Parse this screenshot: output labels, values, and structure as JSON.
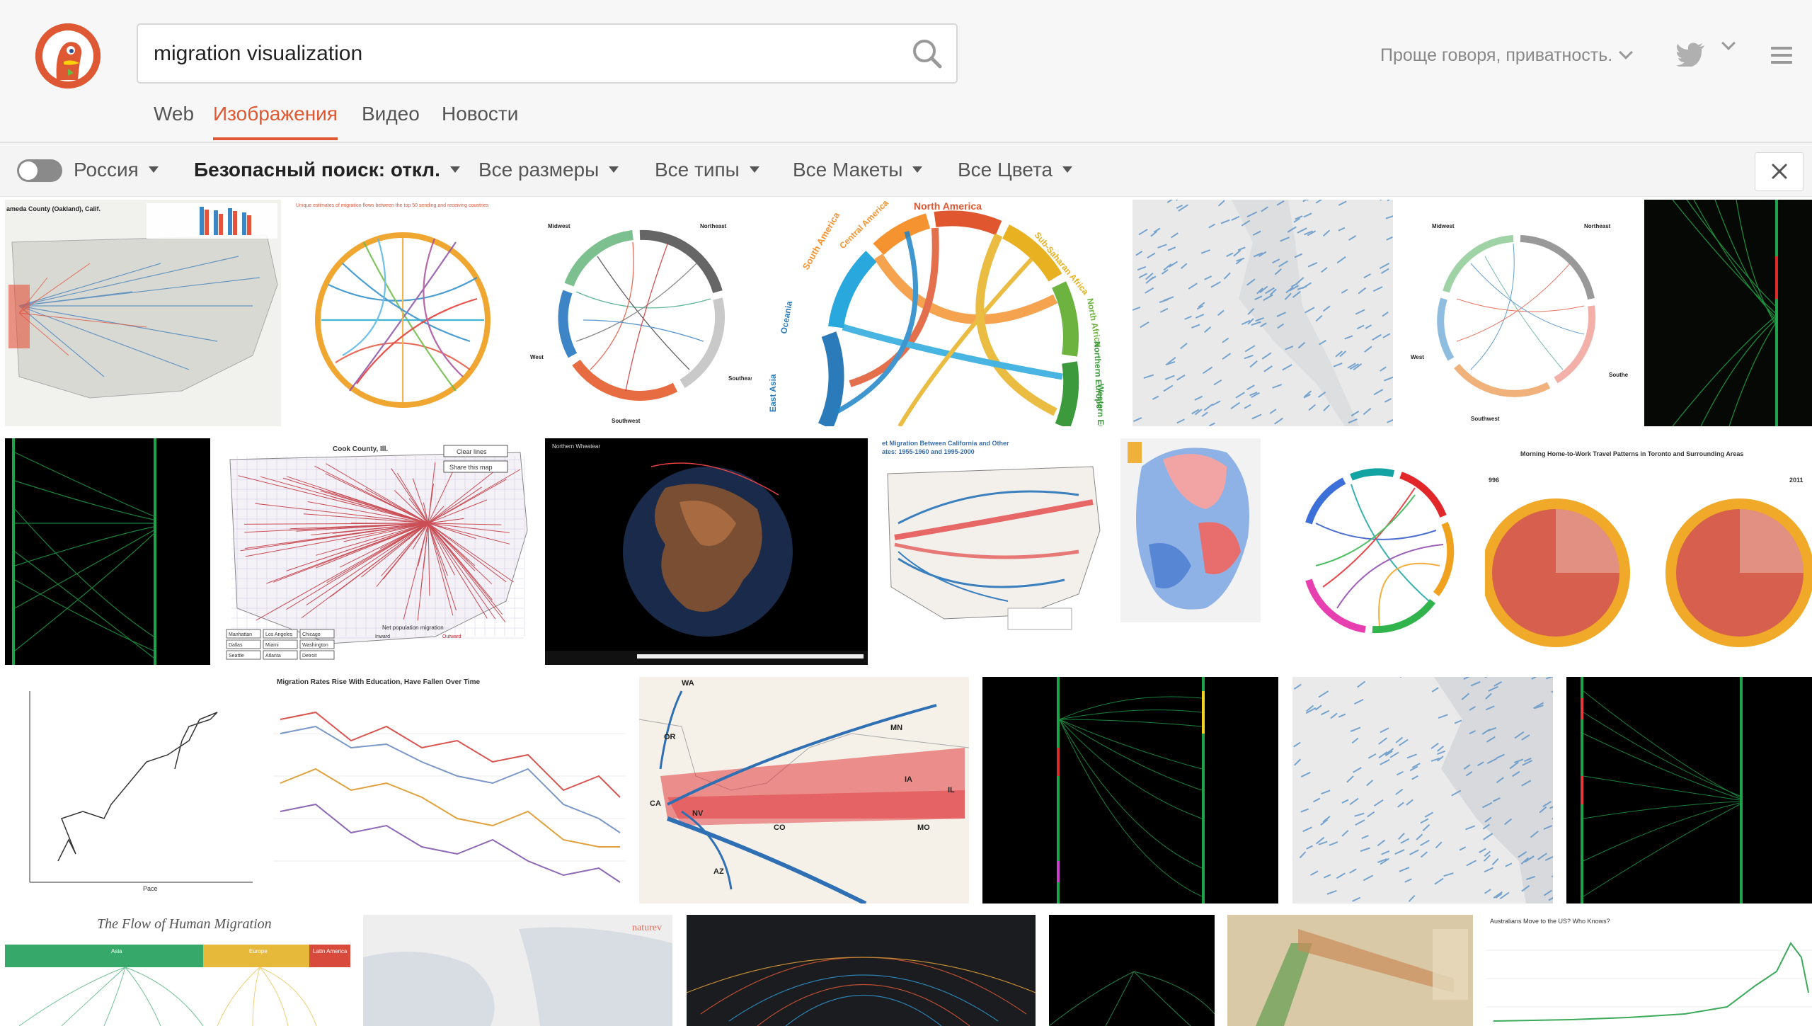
{
  "search": {
    "query": "migration visualization"
  },
  "header": {
    "privacy_label": "Проще говоря, приватность."
  },
  "tabs": [
    {
      "label": "Web"
    },
    {
      "label": "Изображения"
    },
    {
      "label": "Видео"
    },
    {
      "label": "Новости"
    }
  ],
  "filters": {
    "region": "Россия",
    "safe_search": "Безопасный поиск: откл.",
    "size": "Все размеры",
    "type": "Все типы",
    "layout": "Все Макеты",
    "color": "Все Цвета"
  },
  "thumbnail_text": {
    "t1": "ameda County (Oakland), Calif.",
    "t2": "Unique estimates of migration flows between the top 50 sending and receiving countries",
    "t3_w": "Midwest",
    "t3_n": "Northeast",
    "t3_s": "Southwest",
    "t3_west": "West",
    "t3_se": "Southeast",
    "t4_na": "North America",
    "t4_sa": "South America",
    "t4_ca": "Central America",
    "t4_ssa": "Sub-Saharan Africa",
    "t4_nafr": "North Africa",
    "t4_ne": "Northern Europe",
    "t4_we": "Western Europe",
    "t4_oc": "Oceania",
    "t4_ea": "East Asia",
    "t6_w": "Midwest",
    "t6_n": "Northeast",
    "t6_s": "Southwest",
    "t6_west": "West",
    "t6_se": "Southe",
    "t9": "Cook County, Ill.",
    "t9_clear": "Clear lines",
    "t9_share": "Share this map",
    "t9_net": "Net population migration",
    "t9_in": "Inward",
    "t9_out": "Outward",
    "t9_c1": "Manhattan",
    "t9_c2": "Los Angeles",
    "t9_c3": "Chicago",
    "t9_c4": "Dallas",
    "t9_c5": "Miami",
    "t9_c6": "Washington",
    "t9_c7": "Seattle",
    "t9_c8": "Atlanta",
    "t9_c9": "Detroit",
    "t10": "Northern Wheatear",
    "t11": "et Migration Between California and Other",
    "t11b": "ates: 1955-1960 and 1995-2000",
    "t14": "Morning Home-to-Work Travel Patterns in Toronto and Surrounding Areas",
    "t14_l": "996",
    "t14_r": "2011",
    "t15_x": "Pace",
    "t16": "Migration Rates Rise With Education, Have Fallen Over Time",
    "t17_ca": "CA",
    "t17_wa": "WA",
    "t17_or": "OR",
    "t17_nv": "NV",
    "t17_az": "AZ",
    "t17_co": "CO",
    "t17_mn": "MN",
    "t17_ia": "IA",
    "t17_il": "IL",
    "t17_mo": "MO",
    "t21": "The Flow of Human Migration",
    "t21_a": "Asia",
    "t21_b": "Europe",
    "t21_c": "Latin America",
    "t22": "naturev",
    "t26": "Australians Move to the US? Who Knows?"
  }
}
